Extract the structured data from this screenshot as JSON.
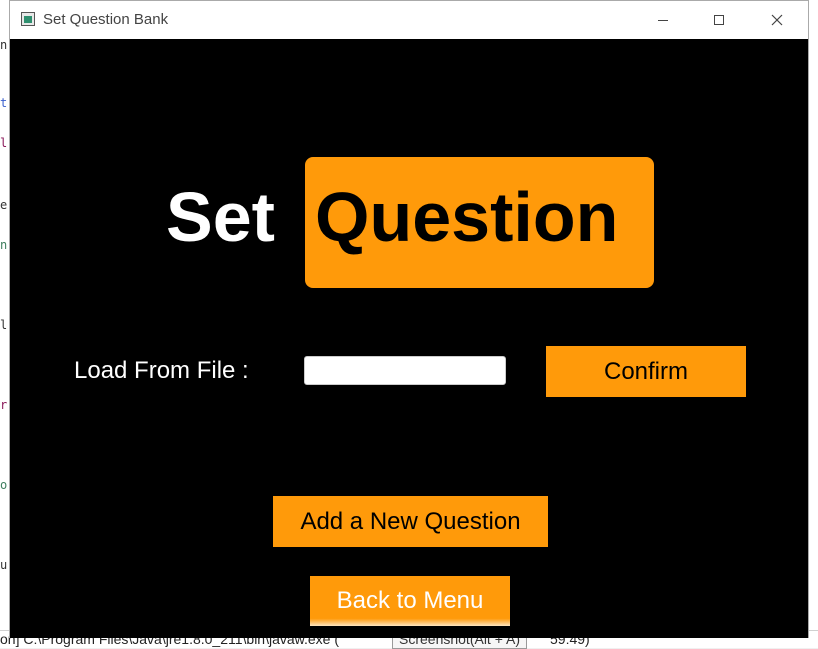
{
  "window": {
    "title": "Set Question Bank"
  },
  "hero": {
    "word1": "Set",
    "word2": "Question"
  },
  "load": {
    "label": "Load From File :",
    "input_value": "",
    "input_placeholder": ""
  },
  "buttons": {
    "confirm": "Confirm",
    "add_question": "Add a New Question",
    "back_to_menu": "Back to Menu"
  },
  "background": {
    "console_text": "on] C:\\Program Files\\Java\\jre1.8.0_211\\bin\\javaw.exe (",
    "console_time": "59:49)",
    "tooltip": "Screenshot(Alt + A)"
  },
  "colors": {
    "accent": "#ff9a0a",
    "panel_bg": "#000000",
    "hero_text": "#ffffff"
  }
}
